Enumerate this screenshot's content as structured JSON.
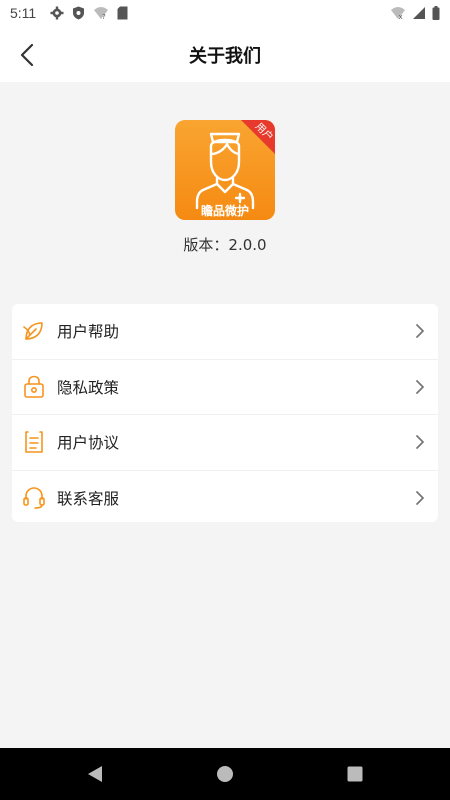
{
  "status_bar": {
    "time": "5:11",
    "left_icons": [
      "gear-icon",
      "shield-icon",
      "wifi-question-icon",
      "sd-card-icon"
    ],
    "right_icons": [
      "wifi-x-icon",
      "signal-icon",
      "battery-icon"
    ]
  },
  "header": {
    "title": "关于我们",
    "back_icon": "chevron-left-icon"
  },
  "app": {
    "logo_badge": "用户",
    "logo_text": "瞻品微护",
    "version": "版本：2.0.0",
    "brand_color": "#f7941d"
  },
  "menu": {
    "items": [
      {
        "label": "用户帮助",
        "icon": "leaf-icon"
      },
      {
        "label": "隐私政策",
        "icon": "lock-icon"
      },
      {
        "label": "用户协议",
        "icon": "document-icon"
      },
      {
        "label": "联系客服",
        "icon": "headset-icon"
      }
    ]
  },
  "nav_bar": {
    "buttons": [
      "back-triangle-icon",
      "home-circle-icon",
      "recents-square-icon"
    ]
  }
}
